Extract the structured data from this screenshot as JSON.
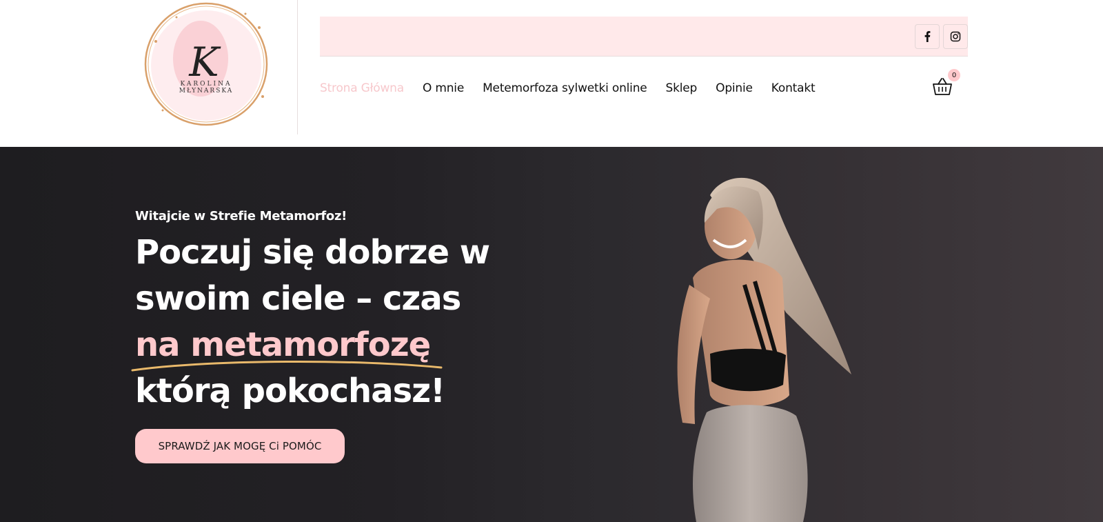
{
  "logo": {
    "monogram": "K",
    "name_line1": "KAROLINA",
    "name_line2": "MŁYNARSKA"
  },
  "social": {
    "facebook_icon": "facebook-icon",
    "instagram_icon": "instagram-icon"
  },
  "nav": {
    "items": [
      {
        "label": "Strona Główna",
        "active": true
      },
      {
        "label": "O mnie"
      },
      {
        "label": "Metemorfoza sylwetki online"
      },
      {
        "label": "Sklep"
      },
      {
        "label": "Opinie"
      },
      {
        "label": "Kontakt"
      }
    ]
  },
  "cart": {
    "icon": "basket-icon",
    "count": "0"
  },
  "hero": {
    "kicker": "Witajcie w Strefie Metamorfoz!",
    "title_line1": "Poczuj się dobrze w",
    "title_line2": "swoim ciele – czas",
    "title_highlight": "na metamorfozę",
    "title_line4": "którą pokochasz!",
    "cta_label": "SPRAWDŹ JAK MOGĘ Ci POMÓC"
  },
  "colors": {
    "accent_pink": "#ffc9cc",
    "topbar_bg": "#ffe9ea",
    "hero_dark": "#1e1d20",
    "underline_gold": "#e9b96b"
  }
}
